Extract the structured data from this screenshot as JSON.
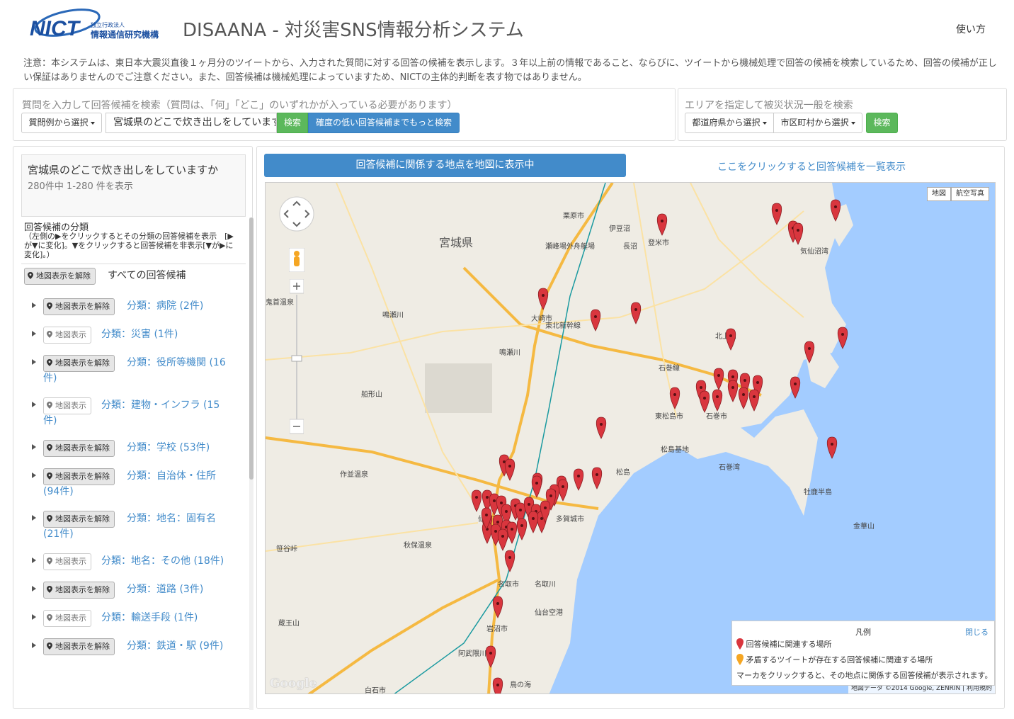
{
  "header": {
    "logo_text": "NICT",
    "logo_sub1": "独立行政法人",
    "logo_sub2": "情報通信研究機構",
    "title": "DISAANA - 対災害SNS情報分析システム",
    "help_link": "使い方"
  },
  "notice": "注意：本システムは、東日本大震災直後１ヶ月分のツイートから、入力された質問に対する回答の候補を表示します。３年以上前の情報であること、ならびに、ツイートから機械処理で回答の候補を検索しているため、回答の候補が正しい保証はありませんのでご注意ください。また、回答候補は機械処理によっていますため、NICTの主体的判断を表す物ではありません。",
  "question_panel": {
    "label": "質問を入力して回答候補を検索（質問は、「何」「どこ」のいずれかが入っている必要があります）",
    "example_button": "質問例から選択",
    "input_value": "宮城県のどこで炊き出しをしていますか",
    "search_button": "検索",
    "more_button": "確度の低い回答候補までもっと検索"
  },
  "area_panel": {
    "label": "エリアを指定して被災状況一般を検索",
    "pref_button": "都道府県から選択",
    "city_button": "市区町村から選択",
    "search_button": "検索"
  },
  "results": {
    "question": "宮城県のどこで炊き出しをしていますか",
    "count": "280件中 1-280 件を表示",
    "cat_title": "回答候補の分類",
    "cat_desc": "（左側の▶をクリックするとその分類の回答候補を表示　[▶が▼に変化]。▼をクリックすると回答候補を非表示[▼が▶に変化]。）",
    "all_button": "地図表示を解除",
    "all_label": "すべての回答候補",
    "categories": [
      {
        "button": "地図表示を解除",
        "label": "分類：病院 (2件)",
        "on": true
      },
      {
        "button": "地図表示",
        "label": "分類：災害 (1件)",
        "on": false
      },
      {
        "button": "地図表示を解除",
        "label": "分類：役所等機関 (16",
        "label2": "件)",
        "on": true
      },
      {
        "button": "地図表示",
        "label": "分類：建物・インフラ (15",
        "label2": "件)",
        "on": false
      },
      {
        "button": "地図表示を解除",
        "label": "分類：学校 (53件)",
        "on": true
      },
      {
        "button": "地図表示を解除",
        "label": "分類：自治体・住所",
        "label2": "(94件)",
        "on": true
      },
      {
        "button": "地図表示を解除",
        "label": "分類：地名：固有名",
        "label2": "(21件)",
        "on": true
      },
      {
        "button": "地図表示",
        "label": "分類：地名：その他 (18件)",
        "on": false
      },
      {
        "button": "地図表示を解除",
        "label": "分類：道路 (3件)",
        "on": true
      },
      {
        "button": "地図表示",
        "label": "分類：輸送手段 (1件)",
        "on": false
      },
      {
        "button": "地図表示を解除",
        "label": "分類：鉄道・駅 (9件)",
        "on": true
      }
    ]
  },
  "map_panel": {
    "showing_button": "回答候補に関係する地点を地図に表示中",
    "list_link": "ここをクリックすると回答候補を一覧表示",
    "map_type_map": "地図",
    "map_type_sat": "航空写真",
    "legend_title": "凡例",
    "legend_close": "閉じる",
    "legend_red": "回答候補に関連する場所",
    "legend_orange": "矛盾するツイートが存在する回答候補に関連する場所",
    "legend_note": "マーカをクリックすると、その地点に関係する回答候補が表示されます。",
    "attribution": "地図データ ©2014 Google, ZENRIN",
    "terms": "利用規約",
    "google": "Google",
    "colors": {
      "land": "#efece4",
      "sea": "#a3ccff",
      "road": "#f5b942",
      "marker": "#d9363e"
    },
    "places": [
      {
        "name": "宮城県",
        "big": true
      },
      {
        "name": "栗原市"
      },
      {
        "name": "伊豆沼"
      },
      {
        "name": "登米市"
      },
      {
        "name": "長沼"
      },
      {
        "name": "瀬峰場外舟艇場"
      },
      {
        "name": "気仙沼湾"
      },
      {
        "name": "鬼首温泉"
      },
      {
        "name": "鳴瀬川"
      },
      {
        "name": "大崎市"
      },
      {
        "name": "鳴瀬川"
      },
      {
        "name": "北上川"
      },
      {
        "name": "石巻線"
      },
      {
        "name": "東北新幹線"
      },
      {
        "name": "船形山"
      },
      {
        "name": "東松島市"
      },
      {
        "name": "石巻市"
      },
      {
        "name": "松島基地"
      },
      {
        "name": "石巻湾"
      },
      {
        "name": "作並温泉"
      },
      {
        "name": "松島"
      },
      {
        "name": "牡鹿半島"
      },
      {
        "name": "金華山"
      },
      {
        "name": "多賀城市"
      },
      {
        "name": "仙台市"
      },
      {
        "name": "秋保温泉"
      },
      {
        "name": "笹谷峠"
      },
      {
        "name": "名取市"
      },
      {
        "name": "名取川"
      },
      {
        "name": "仙台空港"
      },
      {
        "name": "蔵王山"
      },
      {
        "name": "岩沼市"
      },
      {
        "name": "阿武隈川"
      },
      {
        "name": "鳥の海"
      },
      {
        "name": "白石市"
      }
    ]
  }
}
